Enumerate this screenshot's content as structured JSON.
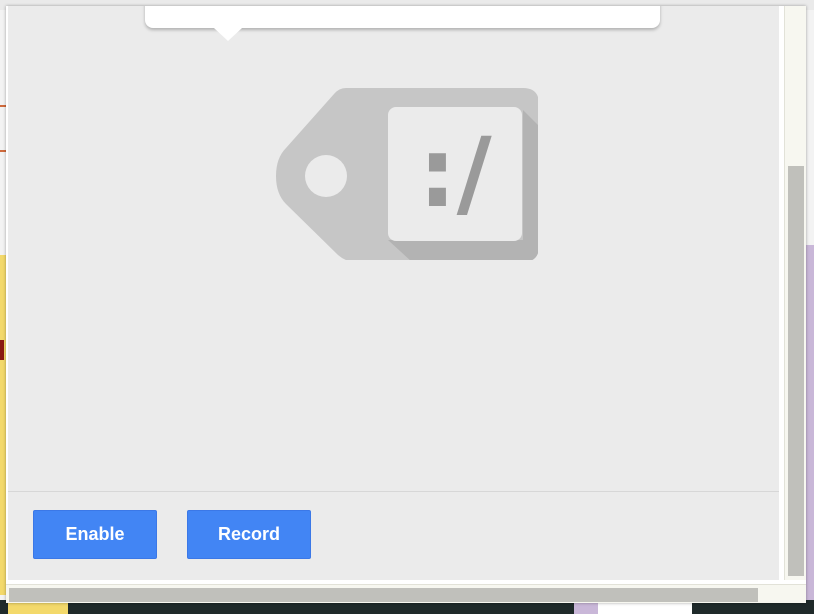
{
  "buttons": {
    "enable_label": "Enable",
    "record_label": "Record"
  },
  "illustration": {
    "icon": "sad-tag-icon",
    "face_text": ":/"
  },
  "colors": {
    "primary_button": "#4285f4",
    "panel_background": "#ebebeb",
    "tag_light": "#c6c6c6",
    "tag_shadow": "#b3b3b3",
    "tag_face": "#ebebeb",
    "tag_glyph": "#9a9a9a"
  }
}
